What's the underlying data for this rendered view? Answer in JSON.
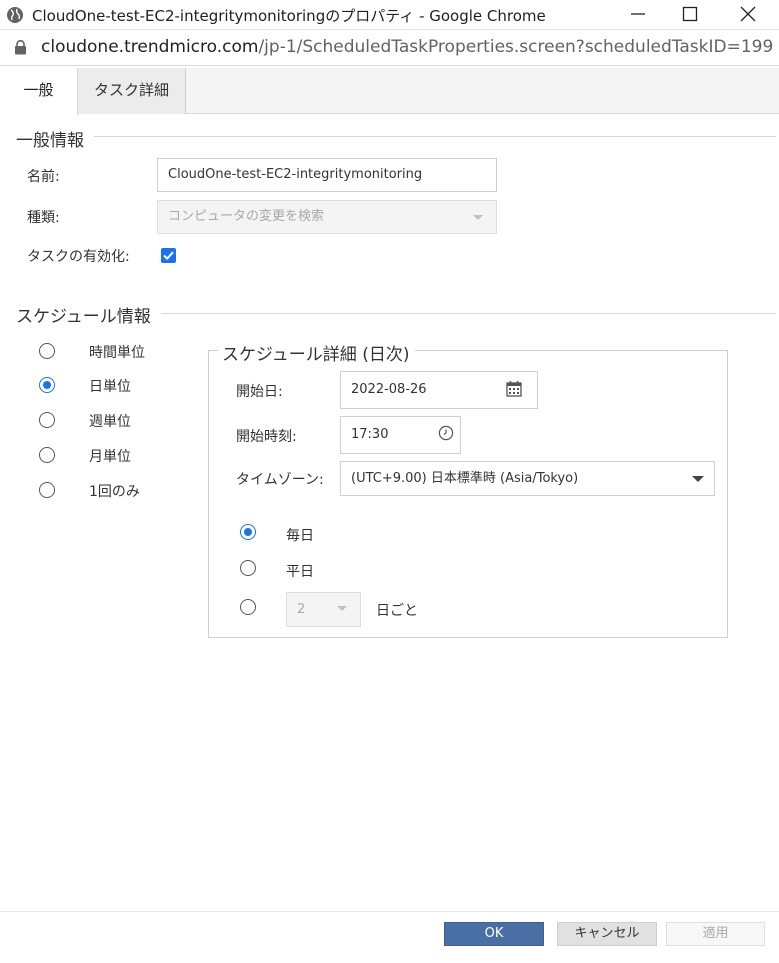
{
  "window": {
    "title": "CloudOne-test-EC2-integritymonitoringのプロパティ - Google Chrome",
    "url_host": "cloudone.trendmicro.com",
    "url_path": "/jp-1/ScheduledTaskProperties.screen?scheduledTaskID=199"
  },
  "tabs": [
    {
      "label": "一般",
      "selected": true
    },
    {
      "label": "タスク詳細",
      "selected": false
    }
  ],
  "general": {
    "heading": "一般情報",
    "name_label": "名前:",
    "name_value": "CloudOne-test-EC2-integritymonitoring",
    "type_label": "種類:",
    "type_value": "コンピュータの変更を検索",
    "enable_label": "タスクの有効化:",
    "enabled": true
  },
  "schedule": {
    "heading": "スケジュール情報",
    "options": [
      {
        "label": "時間単位",
        "selected": false
      },
      {
        "label": "日単位",
        "selected": true
      },
      {
        "label": "週単位",
        "selected": false
      },
      {
        "label": "月単位",
        "selected": false
      },
      {
        "label": "1回のみ",
        "selected": false
      }
    ]
  },
  "detail": {
    "heading": "スケジュール詳細 (日次)",
    "start_date_label": "開始日:",
    "start_date_value": "2022-08-26",
    "start_time_label": "開始時刻:",
    "start_time_value": "17:30",
    "timezone_label": "タイムゾーン:",
    "timezone_value": "(UTC+9.00) 日本標準時 (Asia/Tokyo)",
    "daily_options": [
      {
        "label": "毎日",
        "selected": true
      },
      {
        "label": "平日",
        "selected": false
      },
      {
        "label": "日ごと",
        "selected": false
      }
    ],
    "interval_value": "2"
  },
  "buttons": {
    "ok": "OK",
    "cancel": "キャンセル",
    "apply": "適用"
  },
  "colors": {
    "accent": "#1a73e8",
    "ok_button": "#4a6fa5"
  }
}
